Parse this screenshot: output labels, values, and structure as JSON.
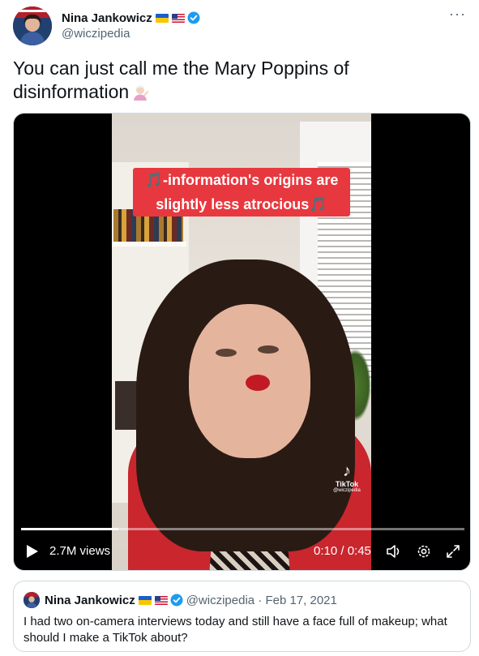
{
  "author": {
    "name": "Nina Jankowicz",
    "handle": "@wiczipedia"
  },
  "more_label": "···",
  "tweet": {
    "text": "You can just call me the Mary Poppins of disinformation"
  },
  "video": {
    "caption_line1": "🎵-information's origins are",
    "caption_line2": "slightly less atrocious🎵",
    "tiktok_logo": "♪",
    "tiktok_name": "TikTok",
    "tiktok_handle": "@wiczipedia",
    "views": "2.7M views",
    "time": "0:10 / 0:45",
    "progress": 0.22
  },
  "quoted": {
    "name": "Nina Jankowicz",
    "handle_date": "@wiczipedia · Feb 17, 2021",
    "text": "I had two on-camera interviews today and still have a face full of makeup; what should I make a TikTok about?"
  },
  "colors": {
    "verified": "#1d9bf0",
    "caption_bg": "#e8383f",
    "secondary_text": "#536471"
  },
  "icons": [
    "more-icon",
    "verified-badge-icon",
    "ukraine-flag-icon",
    "us-flag-icon",
    "shrug-emoji-icon",
    "play-icon",
    "volume-icon",
    "settings-icon",
    "fullscreen-icon"
  ]
}
